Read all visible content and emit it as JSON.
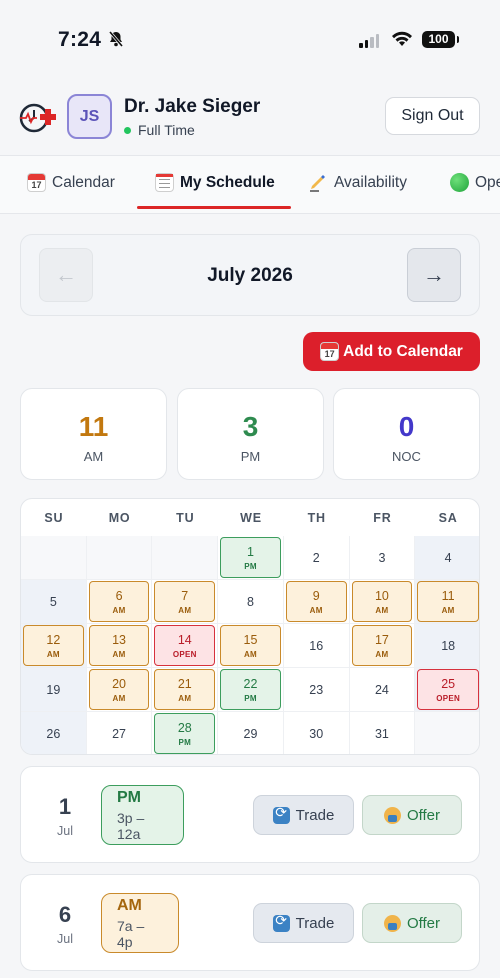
{
  "status_bar": {
    "time": "7:24",
    "battery": "100"
  },
  "header": {
    "avatar_initials": "JS",
    "doctor_name": "Dr. Jake Sieger",
    "employment_status": "Full Time",
    "sign_out_label": "Sign Out"
  },
  "tabs": [
    {
      "label": "Calendar",
      "icon": "calendar-icon"
    },
    {
      "label": "My Schedule",
      "icon": "notepad-icon",
      "active": true
    },
    {
      "label": "Availability",
      "icon": "writing-hand-icon"
    },
    {
      "label": "Ope",
      "icon": "green-circle-icon"
    }
  ],
  "month_nav": {
    "title": "July 2026",
    "prev_glyph": "←",
    "next_glyph": "→"
  },
  "add_to_calendar_label": "Add to Calendar",
  "stats": [
    {
      "value": "11",
      "label": "AM",
      "color": "#c2780f"
    },
    {
      "value": "3",
      "label": "PM",
      "color": "#2e8b4f"
    },
    {
      "value": "0",
      "label": "NOC",
      "color": "#4338ca"
    }
  ],
  "calendar": {
    "weekdays": [
      "SU",
      "MO",
      "TU",
      "WE",
      "TH",
      "FR",
      "SA"
    ],
    "cells": [
      {
        "day": "",
        "shift": ""
      },
      {
        "day": "",
        "shift": ""
      },
      {
        "day": "",
        "shift": ""
      },
      {
        "day": "1",
        "shift": "PM"
      },
      {
        "day": "2",
        "shift": ""
      },
      {
        "day": "3",
        "shift": ""
      },
      {
        "day": "4",
        "shift": ""
      },
      {
        "day": "5",
        "shift": ""
      },
      {
        "day": "6",
        "shift": "AM"
      },
      {
        "day": "7",
        "shift": "AM"
      },
      {
        "day": "8",
        "shift": ""
      },
      {
        "day": "9",
        "shift": "AM"
      },
      {
        "day": "10",
        "shift": "AM"
      },
      {
        "day": "11",
        "shift": "AM"
      },
      {
        "day": "12",
        "shift": "AM"
      },
      {
        "day": "13",
        "shift": "AM"
      },
      {
        "day": "14",
        "shift": "OPEN"
      },
      {
        "day": "15",
        "shift": "AM"
      },
      {
        "day": "16",
        "shift": ""
      },
      {
        "day": "17",
        "shift": "AM"
      },
      {
        "day": "18",
        "shift": ""
      },
      {
        "day": "19",
        "shift": ""
      },
      {
        "day": "20",
        "shift": "AM"
      },
      {
        "day": "21",
        "shift": "AM"
      },
      {
        "day": "22",
        "shift": "PM"
      },
      {
        "day": "23",
        "shift": ""
      },
      {
        "day": "24",
        "shift": ""
      },
      {
        "day": "25",
        "shift": "OPEN"
      },
      {
        "day": "26",
        "shift": ""
      },
      {
        "day": "27",
        "shift": ""
      },
      {
        "day": "28",
        "shift": "PM"
      },
      {
        "day": "29",
        "shift": ""
      },
      {
        "day": "30",
        "shift": ""
      },
      {
        "day": "31",
        "shift": ""
      },
      {
        "day": "",
        "shift": ""
      }
    ]
  },
  "shift_list": [
    {
      "day": "1",
      "month": "Jul",
      "type": "PM",
      "hours": "3p – 12a",
      "trade_label": "Trade",
      "offer_label": "Offer"
    },
    {
      "day": "6",
      "month": "Jul",
      "type": "AM",
      "hours": "7a – 4p",
      "trade_label": "Trade",
      "offer_label": "Offer"
    }
  ]
}
